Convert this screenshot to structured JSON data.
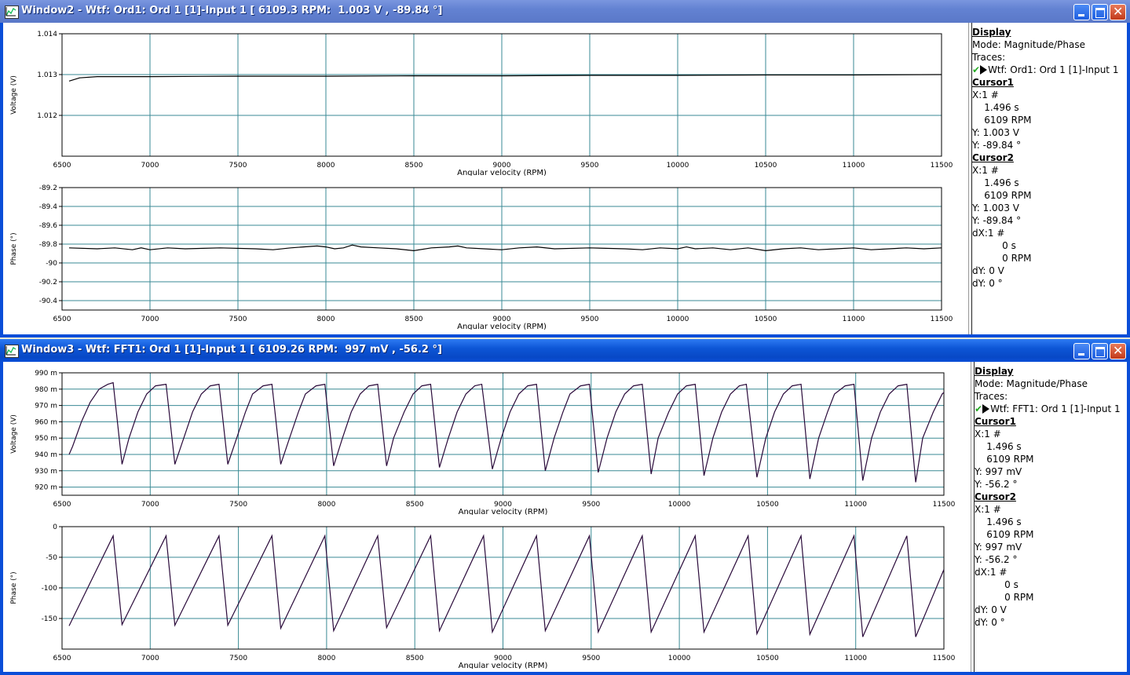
{
  "window2": {
    "title": "Window2 - Wtf: Ord1: Ord 1 [1]-Input 1 [ 6109.3 RPM:  1.003 V , -89.84 °]",
    "panel": [
      {
        "t": "Display",
        "cls": "hd"
      },
      {
        "t": "Mode: Magnitude/Phase"
      },
      {
        "t": "Traces:"
      },
      {
        "t": "Wtf: Ord1: Ord 1 [1]-Input 1",
        "trace": true
      },
      {
        "t": "Cursor1",
        "cls": "hd"
      },
      {
        "t": "X:1 #"
      },
      {
        "t": "    1.496 s"
      },
      {
        "t": "    6109 RPM"
      },
      {
        "t": "Y: 1.003 V"
      },
      {
        "t": "Y: -89.84 °"
      },
      {
        "t": "Cursor2",
        "cls": "hd"
      },
      {
        "t": "X:1 #"
      },
      {
        "t": "    1.496 s"
      },
      {
        "t": "    6109 RPM"
      },
      {
        "t": "Y: 1.003 V"
      },
      {
        "t": "Y: -89.84 °"
      },
      {
        "t": "dX:1 #"
      },
      {
        "t": "          0 s"
      },
      {
        "t": "          0 RPM"
      },
      {
        "t": "dY: 0 V"
      },
      {
        "t": "dY: 0 °"
      }
    ]
  },
  "window3": {
    "title": "Window3 - Wtf: FFT1: Ord 1 [1]-Input 1 [ 6109.26 RPM:  997 mV , -56.2 °]",
    "panel": [
      {
        "t": "Display",
        "cls": "hd"
      },
      {
        "t": "Mode: Magnitude/Phase"
      },
      {
        "t": "Traces:"
      },
      {
        "t": "Wtf: FFT1: Ord 1 [1]-Input 1",
        "trace": true
      },
      {
        "t": "Cursor1",
        "cls": "hd"
      },
      {
        "t": "X:1 #"
      },
      {
        "t": "    1.496 s"
      },
      {
        "t": "    6109 RPM"
      },
      {
        "t": "Y: 997 mV"
      },
      {
        "t": "Y: -56.2 °"
      },
      {
        "t": "Cursor2",
        "cls": "hd"
      },
      {
        "t": "X:1 #"
      },
      {
        "t": "    1.496 s"
      },
      {
        "t": "    6109 RPM"
      },
      {
        "t": "Y: 997 mV"
      },
      {
        "t": "Y: -56.2 °"
      },
      {
        "t": "dX:1 #"
      },
      {
        "t": "          0 s"
      },
      {
        "t": "          0 RPM"
      },
      {
        "t": "dY: 0 V"
      },
      {
        "t": "dY: 0 °"
      }
    ]
  },
  "colors": {
    "grid": "#3A8A94",
    "trace_w2": "#000000",
    "trace_w3": "#2A0A3A"
  },
  "chart_data": [
    {
      "id": "w2-voltage",
      "type": "line",
      "xlabel": "Angular velocity (RPM)",
      "ylabel": "Voltage (V)",
      "xlim": [
        6500,
        11500
      ],
      "xticks": [
        6500,
        7000,
        7500,
        8000,
        8500,
        9000,
        9500,
        10000,
        10500,
        11000,
        11500
      ],
      "ylim": [
        1.011,
        1.014
      ],
      "yticks": [
        1.012,
        1.013,
        1.014
      ],
      "yticklabels": [
        "1.012",
        "1.013",
        "1.014"
      ],
      "series": [
        {
          "x": [
            6540,
            6600,
            6700,
            6800,
            7000,
            7500,
            8000,
            8500,
            9000,
            9500,
            10000,
            10500,
            11000,
            11500
          ],
          "y": [
            1.01284,
            1.01292,
            1.01295,
            1.01295,
            1.01295,
            1.01296,
            1.01296,
            1.01297,
            1.01297,
            1.01298,
            1.01298,
            1.01299,
            1.01299,
            1.013
          ]
        }
      ]
    },
    {
      "id": "w2-phase",
      "type": "line",
      "xlabel": "Angular velocity (RPM)",
      "ylabel": "Phase (°)",
      "xlim": [
        6500,
        11500
      ],
      "xticks": [
        6500,
        7000,
        7500,
        8000,
        8500,
        9000,
        9500,
        10000,
        10500,
        11000,
        11500
      ],
      "ylim": [
        -90.5,
        -89.2
      ],
      "yticks": [
        -90.4,
        -90.2,
        -90,
        -89.8,
        -89.6,
        -89.4,
        -89.2
      ],
      "yticklabels": [
        "-90.4",
        "-90.2",
        "-90",
        "-89.8",
        "-89.6",
        "-89.4",
        "-89.2"
      ],
      "series": [
        {
          "x": [
            6540,
            6700,
            6800,
            6900,
            6950,
            7000,
            7100,
            7200,
            7400,
            7600,
            7700,
            7800,
            7950,
            8000,
            8050,
            8100,
            8150,
            8200,
            8300,
            8400,
            8500,
            8600,
            8700,
            8750,
            8800,
            8900,
            9000,
            9100,
            9200,
            9300,
            9500,
            9700,
            9800,
            9900,
            10000,
            10050,
            10100,
            10200,
            10300,
            10400,
            10500,
            10600,
            10700,
            10800,
            10900,
            11000,
            11100,
            11200,
            11300,
            11400,
            11500
          ],
          "y": [
            -89.84,
            -89.85,
            -89.84,
            -89.86,
            -89.84,
            -89.86,
            -89.84,
            -89.85,
            -89.84,
            -89.85,
            -89.86,
            -89.84,
            -89.82,
            -89.83,
            -89.85,
            -89.84,
            -89.81,
            -89.83,
            -89.84,
            -89.85,
            -89.87,
            -89.84,
            -89.83,
            -89.82,
            -89.84,
            -89.85,
            -89.86,
            -89.84,
            -89.83,
            -89.85,
            -89.84,
            -89.85,
            -89.86,
            -89.84,
            -89.85,
            -89.83,
            -89.85,
            -89.84,
            -89.86,
            -89.84,
            -89.87,
            -89.85,
            -89.84,
            -89.86,
            -89.85,
            -89.84,
            -89.86,
            -89.85,
            -89.84,
            -89.85,
            -89.84
          ]
        }
      ]
    },
    {
      "id": "w3-voltage",
      "type": "line",
      "xlabel": "Angular velocity (RPM)",
      "ylabel": "Voltage (V)",
      "xlim": [
        6500,
        11500
      ],
      "xticks": [
        6500,
        7000,
        7500,
        8000,
        8500,
        9000,
        9500,
        10000,
        10500,
        11000,
        11500
      ],
      "ylim": [
        915,
        990
      ],
      "yticks": [
        920,
        930,
        940,
        950,
        960,
        970,
        980,
        990
      ],
      "yticklabels": [
        "920 m",
        "930 m",
        "940 m",
        "950 m",
        "960 m",
        "970 m",
        "980 m",
        "990 m"
      ],
      "series": [
        {
          "x": [
            6540,
            6560,
            6610,
            6660,
            6710,
            6760,
            6790,
            6840,
            6880,
            6930,
            6980,
            7030,
            7090,
            7140,
            7190,
            7240,
            7290,
            7340,
            7390,
            7440,
            7490,
            7540,
            7580,
            7640,
            7690,
            7740,
            7790,
            7840,
            7880,
            7940,
            7990,
            8040,
            8090,
            8140,
            8190,
            8240,
            8290,
            8340,
            8380,
            8440,
            8490,
            8540,
            8590,
            8640,
            8690,
            8740,
            8790,
            8840,
            8880,
            8940,
            8990,
            9040,
            9090,
            9140,
            9190,
            9240,
            9290,
            9340,
            9380,
            9440,
            9490,
            9540,
            9590,
            9640,
            9690,
            9740,
            9790,
            9840,
            9880,
            9940,
            9990,
            10040,
            10090,
            10140,
            10190,
            10240,
            10290,
            10340,
            10380,
            10440,
            10490,
            10540,
            10590,
            10640,
            10690,
            10740,
            10790,
            10840,
            10880,
            10940,
            10990,
            11040,
            11090,
            11140,
            11190,
            11240,
            11290,
            11340,
            11380,
            11440,
            11490,
            11500
          ],
          "y": [
            940,
            945,
            960,
            972,
            980,
            983,
            984,
            934,
            950,
            966,
            977,
            982,
            983,
            934,
            950,
            966,
            977,
            982,
            983,
            934,
            950,
            966,
            977,
            982,
            983,
            934,
            950,
            966,
            977,
            982,
            983,
            933,
            950,
            966,
            977,
            982,
            983,
            933,
            950,
            966,
            977,
            982,
            983,
            932,
            950,
            966,
            977,
            982,
            983,
            931,
            950,
            966,
            977,
            982,
            983,
            930,
            950,
            966,
            977,
            982,
            983,
            929,
            950,
            966,
            977,
            982,
            983,
            928,
            950,
            966,
            977,
            982,
            983,
            927,
            950,
            966,
            977,
            982,
            983,
            926,
            950,
            966,
            977,
            982,
            983,
            925,
            950,
            966,
            977,
            982,
            983,
            924,
            950,
            966,
            977,
            982,
            983,
            923,
            950,
            966,
            977,
            978
          ]
        }
      ]
    },
    {
      "id": "w3-phase",
      "type": "line",
      "xlabel": "Angular velocity (RPM)",
      "ylabel": "Phase (°)",
      "xlim": [
        6500,
        11500
      ],
      "xticks": [
        6500,
        7000,
        7500,
        8000,
        8500,
        9000,
        9500,
        10000,
        10500,
        11000,
        11500
      ],
      "ylim": [
        -200,
        0
      ],
      "yticks": [
        -150,
        -100,
        -50,
        0
      ],
      "yticklabels": [
        "-150",
        "-100",
        "-50",
        "0"
      ],
      "series": [
        {
          "x": [
            6540,
            6790,
            6840,
            7090,
            7140,
            7390,
            7440,
            7690,
            7740,
            7990,
            8040,
            8290,
            8340,
            8590,
            8640,
            8890,
            8940,
            9190,
            9240,
            9490,
            9540,
            9790,
            9840,
            10090,
            10140,
            10390,
            10440,
            10690,
            10740,
            10990,
            11040,
            11290,
            11340,
            11500
          ],
          "y": [
            -162,
            -15,
            -160,
            -15,
            -161,
            -15,
            -161,
            -15,
            -166,
            -15,
            -170,
            -15,
            -165,
            -15,
            -170,
            -15,
            -172,
            -15,
            -170,
            -15,
            -172,
            -15,
            -172,
            -15,
            -172,
            -15,
            -175,
            -15,
            -176,
            -15,
            -180,
            -15,
            -180,
            -70
          ]
        }
      ]
    }
  ]
}
